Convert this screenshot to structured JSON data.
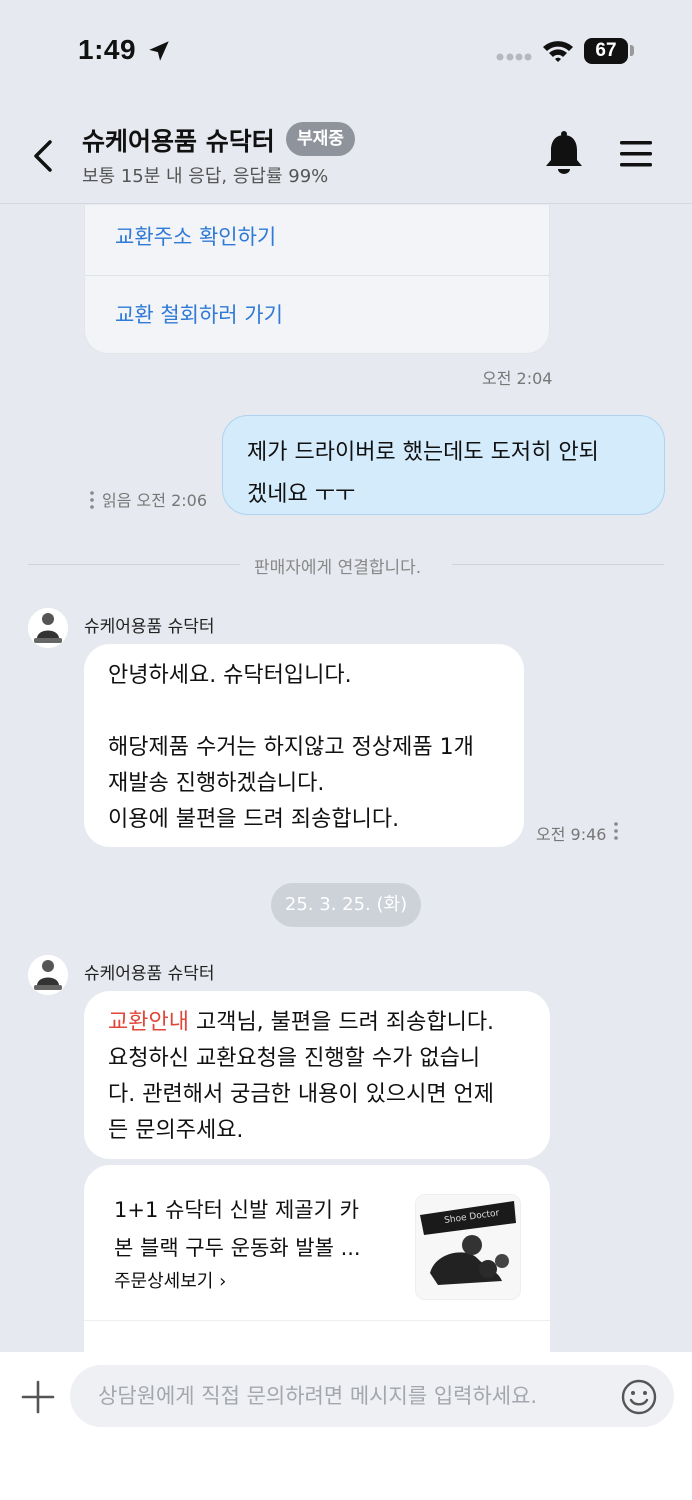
{
  "status_bar": {
    "time": "1:49",
    "battery": "67"
  },
  "header": {
    "title": "슈케어용품 슈닥터",
    "badge": "부재중",
    "subtitle": "보통 15분 내 응답, 응답률 99%"
  },
  "messages": {
    "link_card": {
      "links": [
        "교환주소 확인하기",
        "교환 철회하러 가기"
      ],
      "time": "오전 2:04"
    },
    "my_message": {
      "line1": "제가 드라이버로 했는데도 도저히 안되",
      "line2": "겠네요 ㅜㅜ",
      "read_label": "읽음",
      "time": "오전 2:06"
    },
    "system_notice": "판매자에게 연결합니다.",
    "seller_message_1": {
      "sender": "슈케어용품 슈닥터",
      "text": "안녕하세요. 슈닥터입니다.\n\n해당제품 수거는 하지않고 정상제품 1개\n재발송 진행하겠습니다.\n이용에 불편을 드려 죄송합니다.",
      "time": "오전 9:46"
    },
    "date_divider": "25. 3. 25. (화)",
    "seller_message_2": {
      "sender": "슈케어용품 슈닥터",
      "highlight": "교환안내",
      "text": " 고객님, 불편을 드려 죄송합니다.\n요청하신 교환요청을 진행할 수가 없습니\n다. 관련해서 궁금한 내용이 있으시면 언제\n든 문의주세요."
    },
    "order_card": {
      "product_line1": "1+1 슈닥터 신발 제골기 카",
      "product_line2": "본 블랙 구두 운동화 발볼 ...",
      "detail_link": "주문상세보기 ›",
      "thumb_text": "Shoe Doctor"
    }
  },
  "input": {
    "placeholder": "상담원에게 직접 문의하려면 메시지를 입력하세요."
  },
  "icons": {
    "back": "chevron-left-icon",
    "bell": "bell-icon",
    "menu": "hamburger-menu-icon",
    "plus": "plus-icon",
    "emoji": "smile-icon"
  },
  "colors": {
    "background": "#e6e9ef",
    "my_bubble": "#d4ebfb",
    "link_blue": "#2f7ad6",
    "highlight_red": "#e0473a",
    "badge_gray": "#8f949c"
  }
}
